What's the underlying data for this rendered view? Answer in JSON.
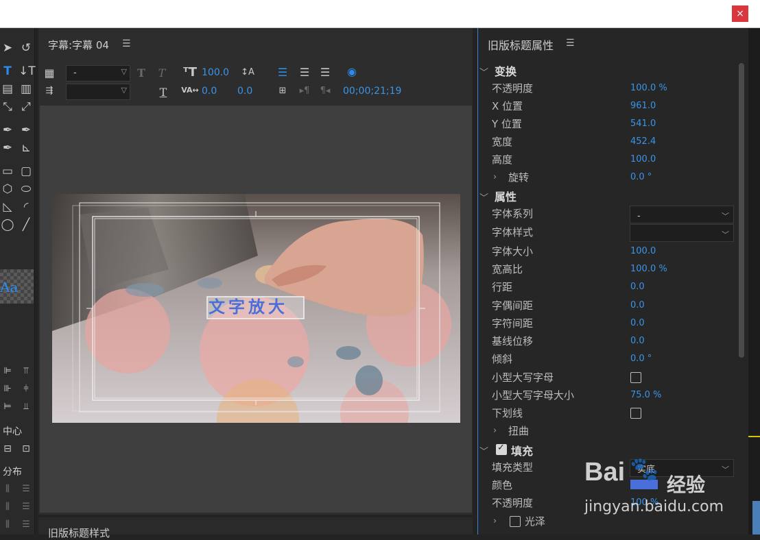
{
  "window": {
    "close_label": "×"
  },
  "title_panel": {
    "title": "字幕:字幕 04",
    "menu_icon": "hamburger-icon",
    "font_family_value": "-",
    "font_size": "100.0",
    "kerning": "0.0",
    "tracking": "0.0",
    "timecode": "00;00;21;19",
    "canvas_text": "文字放大"
  },
  "tool_panel": {
    "align_center_label": "中心",
    "distribute_label": "分布",
    "swatch_label": "Aa"
  },
  "bottom_panel": {
    "title": "旧版标题样式"
  },
  "properties": {
    "title": "旧版标题属性",
    "transform": {
      "section": "变换",
      "opacity_label": "不透明度",
      "opacity": "100.0 %",
      "x_label": "X 位置",
      "x": "961.0",
      "y_label": "Y 位置",
      "y": "541.0",
      "width_label": "宽度",
      "width": "452.4",
      "height_label": "高度",
      "height": "100.0",
      "rotation_label": "旋转",
      "rotation": "0.0 °"
    },
    "attributes": {
      "section": "属性",
      "font_family_label": "字体系列",
      "font_family": "-",
      "font_style_label": "字体样式",
      "font_style": "",
      "font_size_label": "字体大小",
      "font_size": "100.0",
      "aspect_label": "宽高比",
      "aspect": "100.0 %",
      "leading_label": "行距",
      "leading": "0.0",
      "kerning_label": "字偶间距",
      "kerning": "0.0",
      "tracking_label": "字符间距",
      "tracking": "0.0",
      "baseline_label": "基线位移",
      "baseline": "0.0",
      "slant_label": "倾斜",
      "slant": "0.0 °",
      "small_caps_label": "小型大写字母",
      "small_caps_size_label": "小型大写字母大小",
      "small_caps_size": "75.0 %",
      "underline_label": "下划线",
      "distort_label": "扭曲"
    },
    "fill": {
      "section": "填充",
      "type_label": "填充类型",
      "type": "实底",
      "color_label": "颜色",
      "opacity_label": "不透明度",
      "opacity": "100 %",
      "sheen_label": "光泽"
    }
  },
  "watermark": {
    "brand": "Bai",
    "brand2": "经验",
    "url": "jingyan.baidu.com"
  },
  "colors": {
    "accent": "#2d8ceb",
    "value_blue": "#3a95e8",
    "close_red": "#d9363e"
  }
}
